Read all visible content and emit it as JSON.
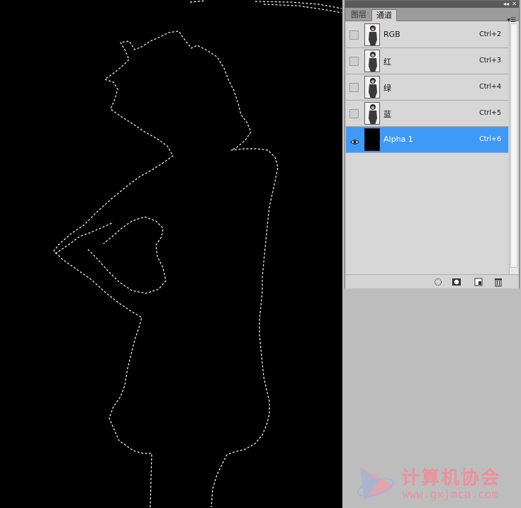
{
  "panel": {
    "tabs": [
      {
        "label": "图层",
        "active": false
      },
      {
        "label": "通道",
        "active": true
      }
    ],
    "channels": [
      {
        "name": "RGB",
        "shortcut": "Ctrl+2",
        "visible": false,
        "selected": false
      },
      {
        "name": "红",
        "shortcut": "Ctrl+3",
        "visible": false,
        "selected": false
      },
      {
        "name": "绿",
        "shortcut": "Ctrl+4",
        "visible": false,
        "selected": false
      },
      {
        "name": "蓝",
        "shortcut": "Ctrl+5",
        "visible": false,
        "selected": false
      },
      {
        "name": "Alpha 1",
        "shortcut": "Ctrl+6",
        "visible": true,
        "selected": true
      }
    ],
    "footer_icons": [
      "load-selection-icon",
      "save-selection-icon",
      "new-channel-icon",
      "trash-icon"
    ],
    "selected_color": "#3f9af7"
  },
  "watermark": {
    "title": "计算机协会",
    "url": "www.gxjmca.com",
    "color": "#e9929c"
  }
}
